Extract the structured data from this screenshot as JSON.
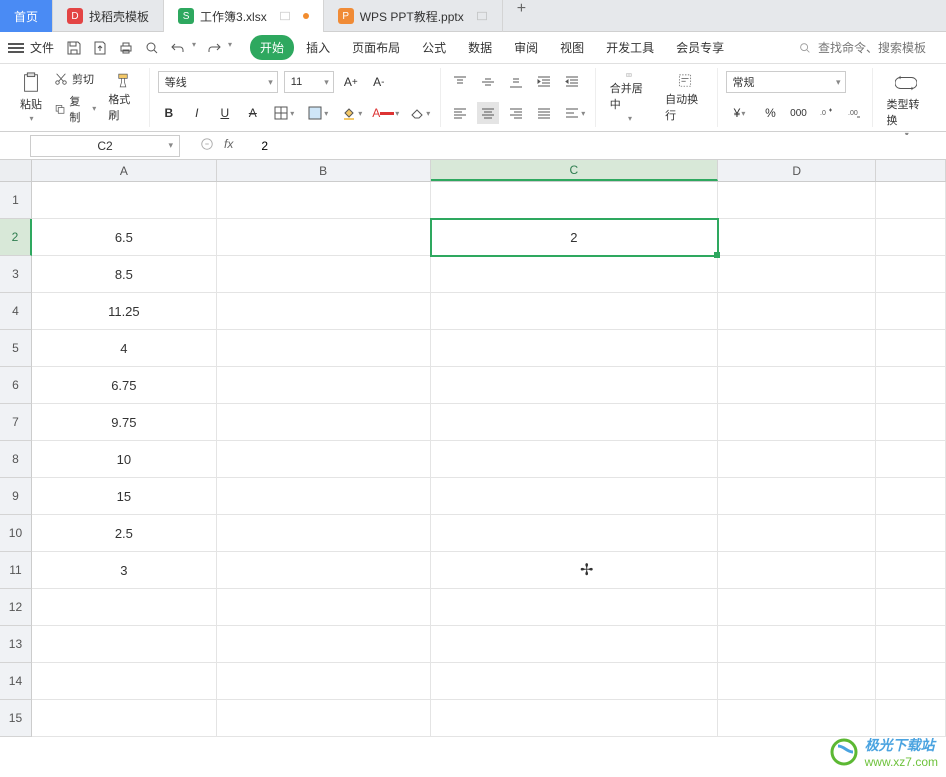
{
  "tabs": {
    "home": "首页",
    "template": "找稻壳模板",
    "workbook": "工作簿3.xlsx",
    "ppt": "WPS PPT教程.pptx"
  },
  "menu": {
    "file": "文件",
    "items": [
      "开始",
      "插入",
      "页面布局",
      "公式",
      "数据",
      "审阅",
      "视图",
      "开发工具",
      "会员专享"
    ],
    "search_placeholder": "查找命令、搜索模板"
  },
  "ribbon": {
    "paste": "粘贴",
    "cut": "剪切",
    "copy": "复制",
    "format_painter": "格式刷",
    "font_name": "等线",
    "font_size": "11",
    "merge": "合并居中",
    "wrap": "自动换行",
    "number_format": "常规",
    "type_convert": "类型转换"
  },
  "formula": {
    "cell_ref": "C2",
    "fx": "fx",
    "value": "2"
  },
  "columns": [
    "A",
    "B",
    "C",
    "D"
  ],
  "selected_col": "C",
  "selected_row": 2,
  "rows": [
    {
      "n": 1,
      "A": "",
      "C": ""
    },
    {
      "n": 2,
      "A": "6.5",
      "C": "2"
    },
    {
      "n": 3,
      "A": "8.5",
      "C": ""
    },
    {
      "n": 4,
      "A": "11.25",
      "C": ""
    },
    {
      "n": 5,
      "A": "4",
      "C": ""
    },
    {
      "n": 6,
      "A": "6.75",
      "C": ""
    },
    {
      "n": 7,
      "A": "9.75",
      "C": ""
    },
    {
      "n": 8,
      "A": "10",
      "C": ""
    },
    {
      "n": 9,
      "A": "15",
      "C": ""
    },
    {
      "n": 10,
      "A": "2.5",
      "C": ""
    },
    {
      "n": 11,
      "A": "3",
      "C": ""
    },
    {
      "n": 12,
      "A": "",
      "C": ""
    },
    {
      "n": 13,
      "A": "",
      "C": ""
    },
    {
      "n": 14,
      "A": "",
      "C": ""
    },
    {
      "n": 15,
      "A": "",
      "C": ""
    }
  ],
  "watermark": {
    "line1": "极光下载站",
    "line2": "www.xz7.com"
  }
}
